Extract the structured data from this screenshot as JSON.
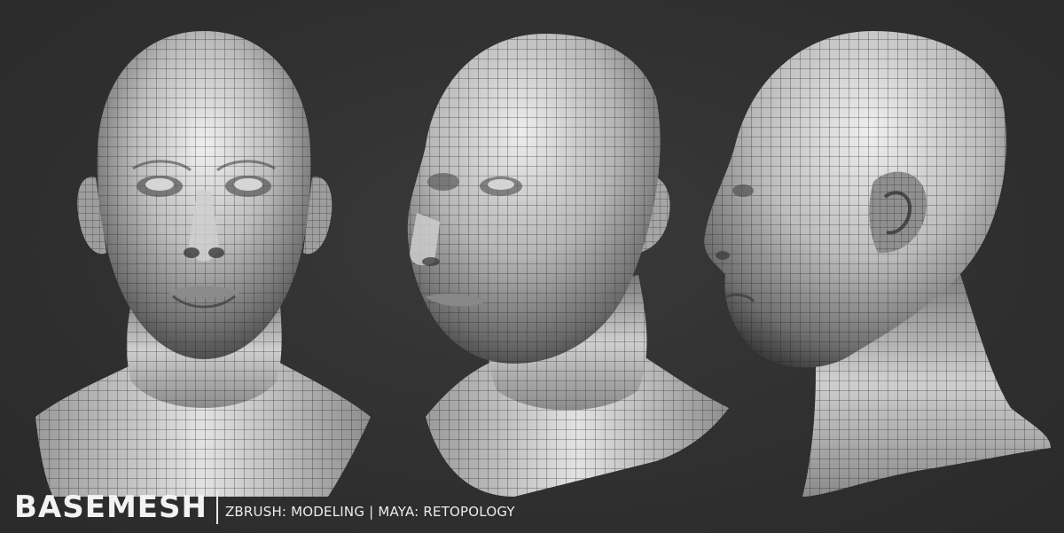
{
  "caption": {
    "title": "BASEMESH",
    "subtitle": "ZBRUSH: MODELING | MAYA: RETOPOLOGY"
  },
  "views": [
    {
      "view": "front"
    },
    {
      "view": "three-quarter"
    },
    {
      "view": "side"
    }
  ],
  "colors": {
    "background": "#2f2f2f",
    "mesh_light": "#e6e6e6",
    "mesh_dark": "#5a5a5a",
    "wire": "#1f1f1f",
    "caption_text": "#f2f2f2"
  }
}
